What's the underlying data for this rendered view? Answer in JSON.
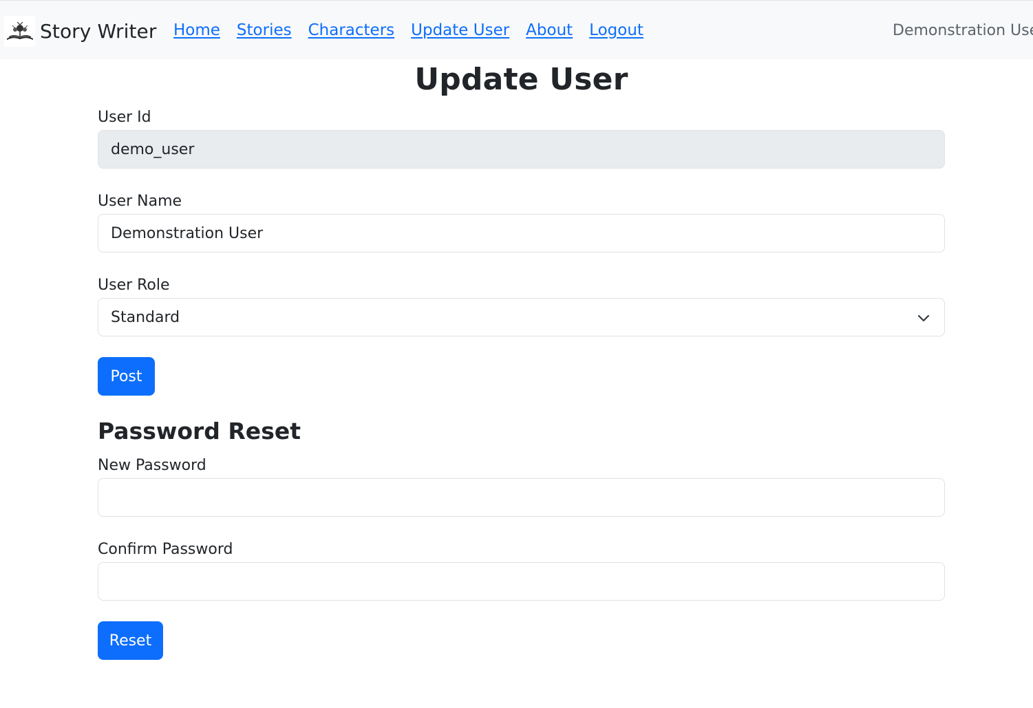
{
  "navbar": {
    "brand": "Story Writer",
    "brand_logo_icon": "story-writer-logo-icon",
    "links": [
      {
        "label": "Home"
      },
      {
        "label": "Stories"
      },
      {
        "label": "Characters"
      },
      {
        "label": "Update User"
      },
      {
        "label": "About"
      },
      {
        "label": "Logout"
      }
    ],
    "user_display": "Demonstration Use"
  },
  "page": {
    "title": "Update User"
  },
  "user_form": {
    "user_id_label": "User Id",
    "user_id_value": "demo_user",
    "user_name_label": "User Name",
    "user_name_value": "Demonstration User",
    "user_role_label": "User Role",
    "user_role_value": "Standard",
    "post_button": "Post"
  },
  "password_reset": {
    "title": "Password Reset",
    "new_password_label": "New Password",
    "new_password_value": "",
    "confirm_password_label": "Confirm Password",
    "confirm_password_value": "",
    "reset_button": "Reset"
  },
  "colors": {
    "primary": "#0d6efd",
    "navbar_bg": "#f8f9fa",
    "readonly_bg": "#e9ecef"
  }
}
